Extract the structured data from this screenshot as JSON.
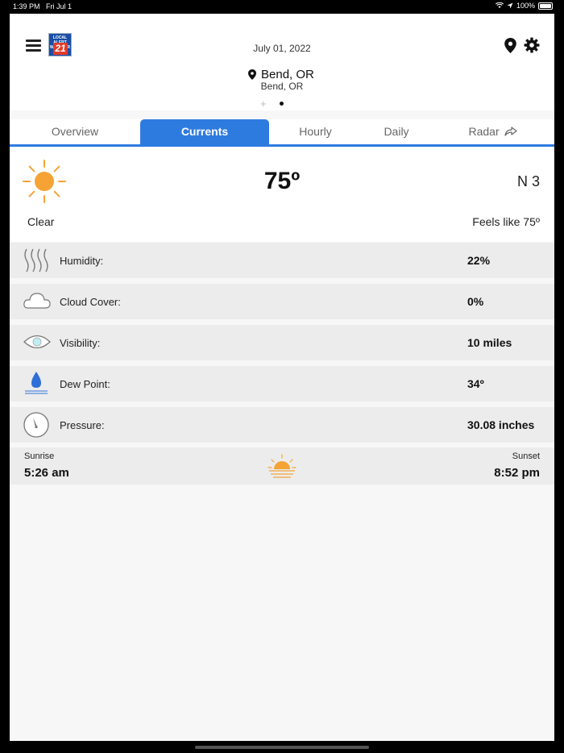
{
  "status_bar": {
    "time": "1:39 PM",
    "date": "Fri Jul 1",
    "battery": "100%"
  },
  "header": {
    "date": "July 01, 2022",
    "location_title": "Bend, OR",
    "location_subtitle": "Bend, OR",
    "page_add": "+",
    "logo_top_text": "LOCAL ALERT WEATHER",
    "logo_number": "21"
  },
  "tabs": [
    {
      "label": "Overview",
      "active": false
    },
    {
      "label": "Currents",
      "active": true
    },
    {
      "label": "Hourly",
      "active": false
    },
    {
      "label": "Daily",
      "active": false
    },
    {
      "label": "Radar",
      "active": false
    }
  ],
  "current": {
    "temperature": "75º",
    "wind": "N 3",
    "condition": "Clear",
    "feels_like": "Feels like 75º",
    "icon": "sun-icon"
  },
  "details": [
    {
      "label": "Humidity:",
      "value": "22%",
      "icon": "humidity-icon"
    },
    {
      "label": "Cloud Cover:",
      "value": "0%",
      "icon": "cloud-icon"
    },
    {
      "label": "Visibility:",
      "value": "10 miles",
      "icon": "eye-icon"
    },
    {
      "label": "Dew Point:",
      "value": "34º",
      "icon": "dew-drop-icon"
    },
    {
      "label": "Pressure:",
      "value": "30.08 inches",
      "icon": "gauge-icon"
    }
  ],
  "sun": {
    "sunrise_label": "Sunrise",
    "sunrise_time": "5:26 am",
    "sunset_label": "Sunset",
    "sunset_time": "8:52 pm"
  },
  "colors": {
    "accent": "#2e7be0",
    "sun": "#f5a335"
  }
}
